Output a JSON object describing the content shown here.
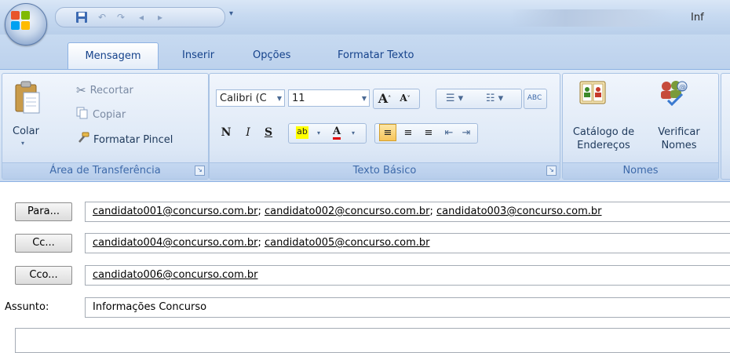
{
  "window": {
    "title": "Inf"
  },
  "tabs": [
    {
      "label": "Mensagem",
      "active": true
    },
    {
      "label": "Inserir"
    },
    {
      "label": "Opções"
    },
    {
      "label": "Formatar Texto"
    }
  ],
  "ribbon": {
    "clipboard": {
      "label": "Área de Transferência",
      "paste": "Colar",
      "cut": "Recortar",
      "copy": "Copiar",
      "format_painter": "Formatar Pincel"
    },
    "basic_text": {
      "label": "Texto Básico",
      "font_name": "Calibri (C",
      "font_size": "11",
      "bold": "N",
      "italic": "I",
      "underline": "S"
    },
    "names": {
      "label": "Nomes",
      "address_book_line1": "Catálogo de",
      "address_book_line2": "Endereços",
      "check_names_line1": "Verificar",
      "check_names_line2": "Nomes"
    }
  },
  "message": {
    "to_button": "Para...",
    "cc_button": "Cc...",
    "bcc_button": "Cco...",
    "to": [
      "candidato001@concurso.com.br",
      "candidato002@concurso.com.br",
      "candidato003@concurso.com.br"
    ],
    "cc": [
      "candidato004@concurso.com.br",
      "candidato005@concurso.com.br"
    ],
    "bcc": [
      "candidato006@concurso.com.br"
    ],
    "subject_label": "Assunto:",
    "subject": "Informações Concurso"
  },
  "colors": {
    "ribbon_bg": "#dde8f6",
    "accent": "#15428b",
    "group_label": "#3e6aaa"
  }
}
